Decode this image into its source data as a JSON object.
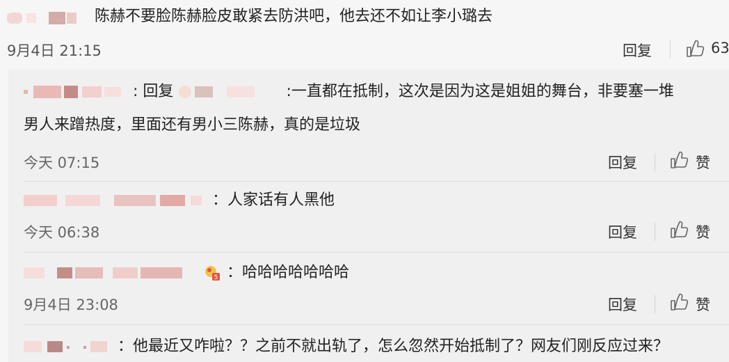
{
  "top_comment": {
    "text": "陈赫不要脸陈赫脸皮敢紧去防洪吧，他去还不如让李小璐去",
    "date": "9月4日 21:15",
    "reply_label": "回复",
    "like_count": "63"
  },
  "replies": [
    {
      "separator": ":",
      "reply_prefix": "回复",
      "text_line1": ":一直都在抵制，这次是因为这是姐姐的舞台，非要塞一堆",
      "text_line2": "男人来蹭热度，里面还有男小三陈赫，真的是垃圾",
      "date": "今天 07:15",
      "reply_label": "回复",
      "like_label": "赞"
    },
    {
      "text": "：人家话有人黑他",
      "date": "今天 06:38",
      "reply_label": "回复",
      "like_label": "赞"
    },
    {
      "text": "：哈哈哈哈哈哈哈",
      "date": "9月4日 23:08",
      "reply_label": "回复",
      "like_label": "赞"
    },
    {
      "text": "：他最近又咋啦？？之前不就出轨了，怎么忽然开始抵制了？网友们刚反应过来？"
    }
  ],
  "colors": {
    "background": "#f6f6f6",
    "replies_background": "#f0f0f0",
    "blurred_name": "#e8b4b0"
  }
}
